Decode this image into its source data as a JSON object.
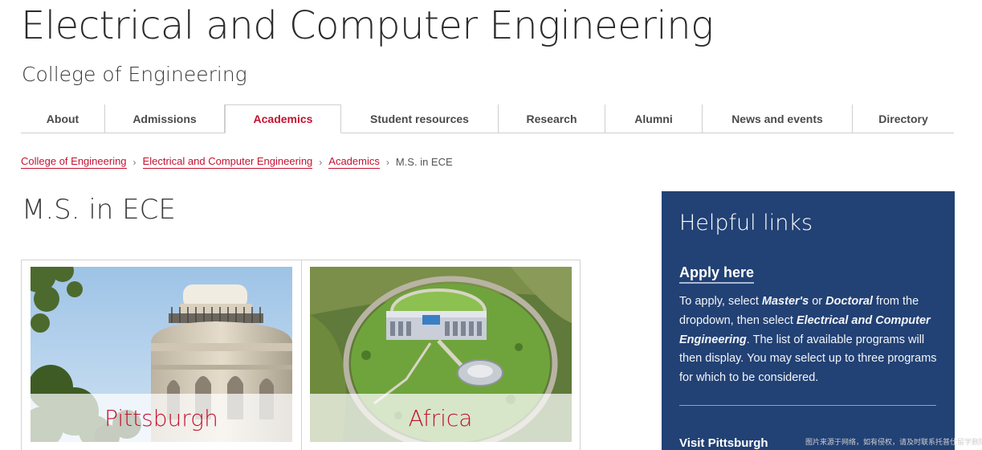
{
  "header": {
    "title": "Electrical and Computer Engineering",
    "subtitle": "College of Engineering"
  },
  "nav": {
    "items": [
      {
        "label": "About"
      },
      {
        "label": "Admissions"
      },
      {
        "label": "Academics",
        "active": true
      },
      {
        "label": "Student resources"
      },
      {
        "label": "Research"
      },
      {
        "label": "Alumni"
      },
      {
        "label": "News and events"
      },
      {
        "label": "Directory"
      }
    ],
    "active_color": "#c41230"
  },
  "breadcrumb": {
    "items": [
      {
        "label": "College of Engineering"
      },
      {
        "label": "Electrical and Computer Engineering"
      },
      {
        "label": "Academics"
      }
    ],
    "current": "M.S. in ECE",
    "separator": "›"
  },
  "page": {
    "title": "M.S. in ECE"
  },
  "cards": [
    {
      "label": "Pittsburgh",
      "image": "pittsburgh-tower-photo"
    },
    {
      "label": "Africa",
      "image": "africa-campus-aerial-photo"
    }
  ],
  "sidebar": {
    "title": "Helpful links",
    "apply_label": "Apply here",
    "apply_text": {
      "p1": "To apply, select ",
      "e1": "Master's",
      "p2": " or ",
      "e2": "Doctoral",
      "p3": " from the dropdown, then select ",
      "e3": "Electrical and Computer Engineering",
      "p4": ". The list of available programs will then display. You may select up to three programs for which to be considered."
    },
    "visit_label": "Visit Pittsburgh",
    "background": "#224174"
  },
  "watermark": "图片来源于网络，如有侵权，请及时联系托普仕留学删除"
}
